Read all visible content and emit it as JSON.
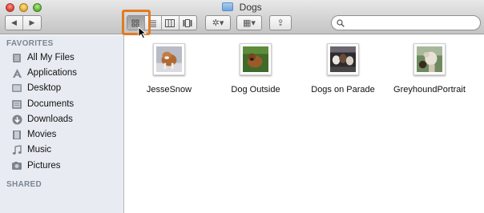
{
  "window": {
    "title": "Dogs"
  },
  "toolbar": {
    "back_icon": "◀",
    "forward_icon": "▶",
    "views": [
      "icon-view",
      "list-view",
      "column-view",
      "coverflow-view"
    ],
    "action_label": "✲▾",
    "arrange_label": "▦▾",
    "share_label": "⇪",
    "search": {
      "value": "",
      "placeholder": ""
    }
  },
  "sidebar": {
    "favorites_title": "FAVORITES",
    "items": [
      {
        "label": "All My Files",
        "icon": "all-files-icon"
      },
      {
        "label": "Applications",
        "icon": "applications-icon"
      },
      {
        "label": "Desktop",
        "icon": "desktop-icon"
      },
      {
        "label": "Documents",
        "icon": "documents-icon"
      },
      {
        "label": "Downloads",
        "icon": "downloads-icon"
      },
      {
        "label": "Movies",
        "icon": "movies-icon"
      },
      {
        "label": "Music",
        "icon": "music-icon"
      },
      {
        "label": "Pictures",
        "icon": "pictures-icon"
      }
    ],
    "shared_title": "SHARED"
  },
  "files": [
    {
      "name": "JesseSnow"
    },
    {
      "name": "Dog Outside"
    },
    {
      "name": "Dogs on Parade"
    },
    {
      "name": "GreyhoundPortrait"
    }
  ],
  "colors": {
    "highlight": "#e07b24",
    "sidebar_bg": "#e8ecf2",
    "section_title": "#7b8593"
  }
}
